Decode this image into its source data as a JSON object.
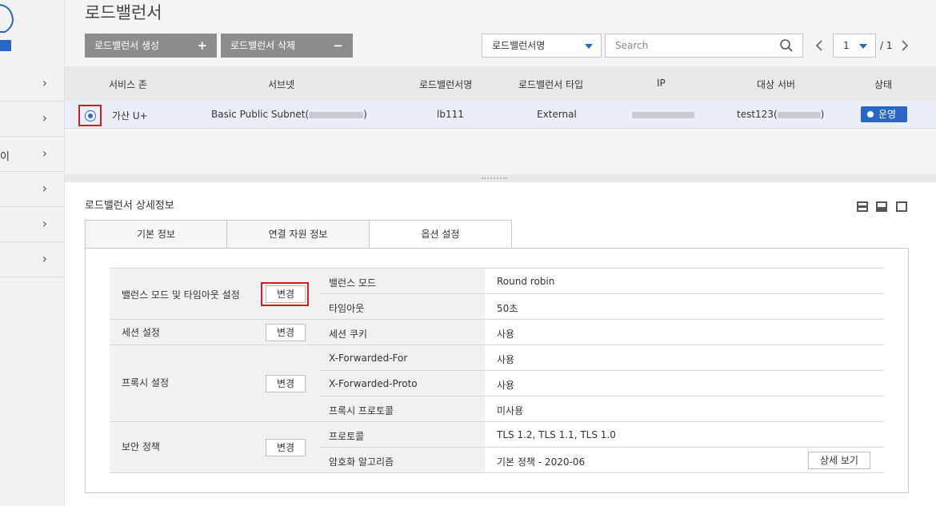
{
  "sidebar": {
    "items": [
      {
        "label": ""
      },
      {
        "label": ""
      },
      {
        "label": "이"
      },
      {
        "label": ""
      },
      {
        "label": ""
      },
      {
        "label": ""
      }
    ]
  },
  "header": {
    "title": "로드밸런서",
    "create_button": "로드밸런서 생성",
    "create_symbol": "+",
    "delete_button": "로드밸런서 삭제",
    "delete_symbol": "−",
    "filter_select": "로드밸런서명",
    "search_placeholder": "Search",
    "page_current": "1",
    "page_total": "/ 1"
  },
  "table": {
    "columns": [
      "서비스 존",
      "서브넷",
      "로드밸런서명",
      "로드밸런서 타입",
      "IP",
      "대상 서버",
      "상태"
    ],
    "rows": [
      {
        "zone": "가산 U+",
        "subnet": "Basic Public Subnet(",
        "subnet_suffix": ")",
        "name": "lb111",
        "type": "External",
        "server": "test123(",
        "server_suffix": ")",
        "status": "운영"
      }
    ]
  },
  "detail": {
    "title": "로드밸런서 상세정보",
    "tabs": [
      "기본 정보",
      "연결 자원 정보",
      "옵션 설정"
    ],
    "active_tab": "옵션 설정",
    "change_label": "변경",
    "sections": [
      {
        "label": "밸런스 모드 및 타임아웃 설정",
        "rows": [
          {
            "key": "밸런스 모드",
            "value": "Round robin"
          },
          {
            "key": "타임아웃",
            "value": "50초"
          }
        ]
      },
      {
        "label": "세션 설정",
        "rows": [
          {
            "key": "세션 쿠키",
            "value": "사용"
          }
        ]
      },
      {
        "label": "프록시 설정",
        "rows": [
          {
            "key": "X-Forwarded-For",
            "value": "사용"
          },
          {
            "key": "X-Forwarded-Proto",
            "value": "사용"
          },
          {
            "key": "프록시 프로토콜",
            "value": "미사용"
          }
        ]
      },
      {
        "label": "보안 정책",
        "rows": [
          {
            "key": "프로토콜",
            "value": "TLS 1.2, TLS 1.1, TLS 1.0"
          },
          {
            "key": "암호화 알고리즘",
            "value": "기본 정책 - 2020-06"
          }
        ]
      }
    ],
    "detail_view_button": "상세 보기"
  },
  "colors": {
    "accent": "#2a66c5",
    "highlight": "#d01c1c",
    "button_gray": "#8c8c8c"
  }
}
